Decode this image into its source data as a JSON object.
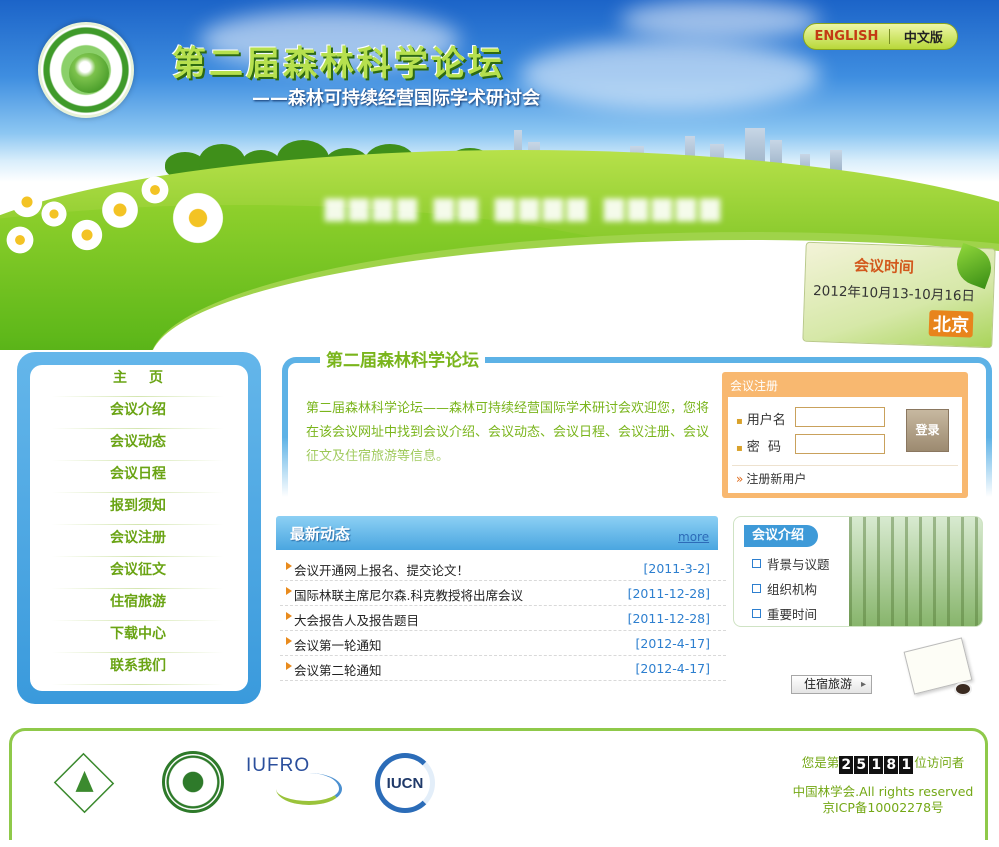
{
  "banner": {
    "site_title": "第二届森林科学论坛",
    "site_subtitle": "——森林可持续经营国际学术研讨会",
    "lang_english": "ENGLISH",
    "lang_chinese": "中文版",
    "date_label": "会议时间",
    "date_range": "2012年10月13-10月16日",
    "date_city": "北京"
  },
  "nav": {
    "items": [
      {
        "label": "主页"
      },
      {
        "label": "会议介绍"
      },
      {
        "label": "会议动态"
      },
      {
        "label": "会议日程"
      },
      {
        "label": "报到须知"
      },
      {
        "label": "会议注册"
      },
      {
        "label": "会议征文"
      },
      {
        "label": "住宿旅游"
      },
      {
        "label": "下载中心"
      },
      {
        "label": "联系我们"
      }
    ]
  },
  "intro": {
    "title": "第二届森林科学论坛",
    "text": "第二届森林科学论坛——森林可持续经营国际学术研讨会欢迎您，您将在该会议网址中找到会议介绍、会议动态、会议日程、会议注册、会议征文及住宿旅游等信息。"
  },
  "login": {
    "title": "会议注册",
    "username_label": "用户名",
    "password_label": "密  码",
    "username_value": "",
    "password_value": "",
    "submit_label": "登录",
    "register_label": "注册新用户"
  },
  "news": {
    "title": "最新动态",
    "more_label": "more",
    "items": [
      {
        "title": "会议开通网上报名、提交论文！",
        "date": "[2011-3-2]"
      },
      {
        "title": "国际林联主席尼尔森.科克教授将出席会议",
        "date": "[2011-12-28]"
      },
      {
        "title": "大会报告人及报告题目",
        "date": "[2011-12-28]"
      },
      {
        "title": "会议第一轮通知",
        "date": "[2012-4-17]"
      },
      {
        "title": "会议第二轮通知",
        "date": "[2012-4-17]"
      }
    ]
  },
  "about": {
    "title": "会议介绍",
    "items": [
      {
        "label": "背景与议题"
      },
      {
        "label": "组织机构"
      },
      {
        "label": "重要时间"
      }
    ],
    "travel_label": "住宿旅游"
  },
  "footer": {
    "partners": [
      {
        "name": "csf-logo"
      },
      {
        "name": "bjfu-logo"
      },
      {
        "name": "iufro-logo",
        "text": "IUFRO"
      },
      {
        "name": "iucn-logo",
        "text": "IUCN"
      }
    ],
    "visitor_prefix": "您是第",
    "visitor_digits": [
      "2",
      "5",
      "1",
      "8",
      "1"
    ],
    "visitor_suffix": "位访问者",
    "copyright": "中国林学会.All rights reserved",
    "icp": "京ICP备10002278号"
  },
  "colors": {
    "accent_green": "#7ab51c",
    "accent_blue": "#5db2e6",
    "login_orange": "#f8b870",
    "date_blue": "#2d7fcf"
  }
}
